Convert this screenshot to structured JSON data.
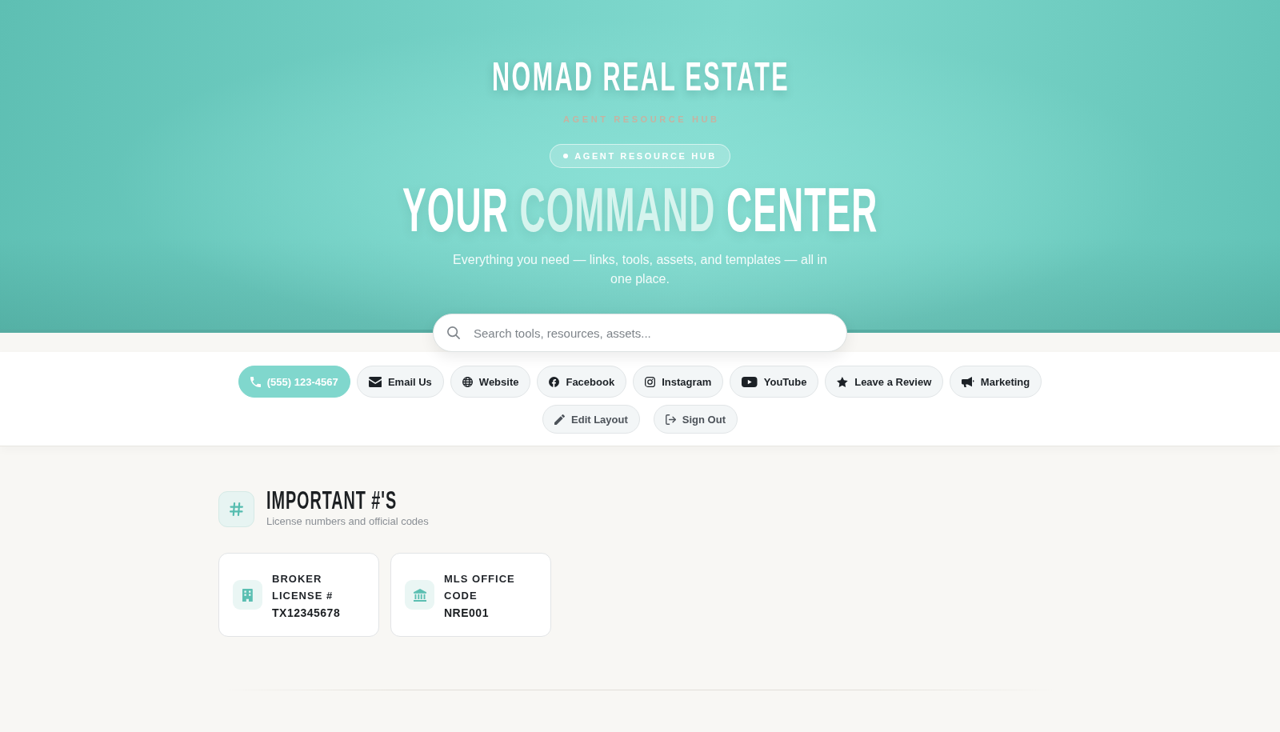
{
  "header": {
    "brand": "NOMAD REAL ESTATE",
    "tagline": "AGENT RESOURCE HUB",
    "badge": "AGENT RESOURCE HUB",
    "headline": [
      {
        "text": "YOUR",
        "accent": false
      },
      {
        "text": "COMMAND",
        "accent": true
      },
      {
        "text": "CENTER",
        "accent": false
      }
    ],
    "description": "Everything you need — links, tools, assets, and templates — all in one place."
  },
  "search": {
    "placeholder": "Search tools, resources, assets..."
  },
  "quick_links": [
    {
      "label": "(555) 123-4567",
      "highlighted": true
    },
    {
      "label": "Email Us",
      "highlighted": false
    },
    {
      "label": "Website",
      "highlighted": false
    },
    {
      "label": "Facebook",
      "highlighted": false
    },
    {
      "label": "Instagram",
      "highlighted": false
    },
    {
      "label": "YouTube",
      "highlighted": false
    },
    {
      "label": "Leave a Review",
      "highlighted": false
    },
    {
      "label": "Marketing",
      "highlighted": false
    }
  ],
  "account_actions": [
    {
      "label": "Edit Layout"
    },
    {
      "label": "Sign Out"
    }
  ],
  "section": {
    "title": "IMPORTANT #'S",
    "subtitle": "License numbers and official codes",
    "cards": [
      {
        "label": "BROKER LICENSE #",
        "value": "TX12345678"
      },
      {
        "label": "MLS OFFICE CODE",
        "value": "NRE001"
      }
    ]
  }
}
